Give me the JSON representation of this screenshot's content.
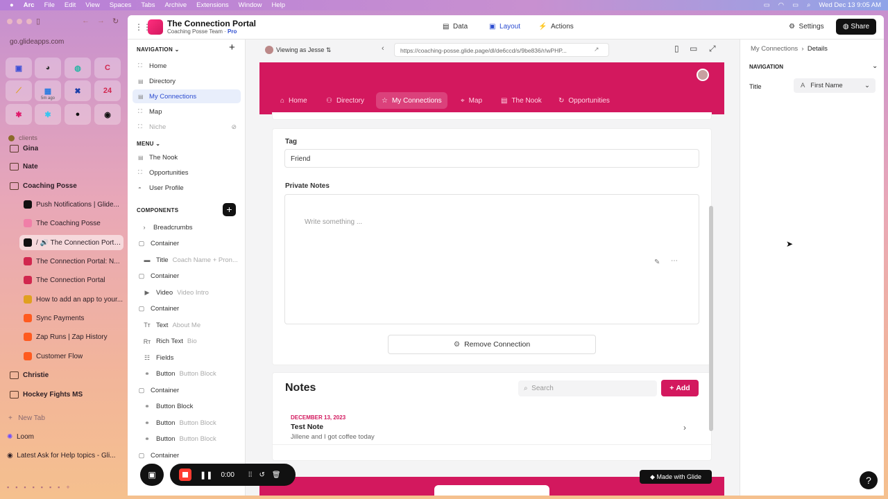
{
  "menubar": {
    "app": "Arc",
    "items": [
      "File",
      "Edit",
      "View",
      "Spaces",
      "Tabs",
      "Archive",
      "Extensions",
      "Window",
      "Help"
    ],
    "datetime": "Wed Dec 13  9:05 AM"
  },
  "arc": {
    "url": "go.glideapps.com",
    "pins": [
      {
        "glyph": "▣",
        "color": "#3c4fd6"
      },
      {
        "glyph": "◕",
        "color": "#333"
      },
      {
        "glyph": "◍",
        "color": "#28b5a5"
      },
      {
        "glyph": "C",
        "color": "#d1274e"
      },
      {
        "glyph": "⟋",
        "color": "#e0a020"
      },
      {
        "glyph": "▦",
        "color": "#2a7be0",
        "badge": "5m ago"
      },
      {
        "glyph": "✖",
        "color": "#1b3ea8"
      },
      {
        "glyph": "24",
        "color": "#d1274e"
      },
      {
        "glyph": "✱",
        "color": "#e0196b"
      },
      {
        "glyph": "✱",
        "color": "#36c5f0"
      },
      {
        "glyph": "●",
        "color": "#111"
      },
      {
        "glyph": "◉",
        "color": "#111"
      }
    ],
    "section": "clients",
    "items": [
      {
        "label": "Gina",
        "type": "folder"
      },
      {
        "label": "Nate",
        "type": "folder"
      },
      {
        "label": "Coaching Posse",
        "type": "folder"
      },
      {
        "label": "Push Notifications | Glide...",
        "type": "tab",
        "color": "#111"
      },
      {
        "label": "The Coaching Posse",
        "type": "tab",
        "color": "#f07fa8"
      },
      {
        "label": "/ 🔊 The Connection Porta...",
        "type": "tab",
        "color": "#111",
        "active": true
      },
      {
        "label": "The Connection Portal: N...",
        "type": "tab",
        "color": "#d1274e"
      },
      {
        "label": "The Connection Portal",
        "type": "tab",
        "color": "#d1274e"
      },
      {
        "label": "How to add an app to your...",
        "type": "tab",
        "color": "#e0a020"
      },
      {
        "label": "Sync Payments",
        "type": "tab",
        "color": "#ff5a1f"
      },
      {
        "label": "Zap Runs | Zap History",
        "type": "tab",
        "color": "#ff5a1f"
      },
      {
        "label": "Customer Flow",
        "type": "tab",
        "color": "#ff5a1f"
      },
      {
        "label": "Christie",
        "type": "folder"
      },
      {
        "label": "Hockey Fights MS",
        "type": "folder"
      }
    ],
    "new_tab": "New Tab",
    "loom": "Loom",
    "latest": "Latest Ask for Help topics - Gli..."
  },
  "glide": {
    "app_name": "The Connection Portal",
    "team": "Coaching Posse Team",
    "plan": "Pro",
    "top_tabs": [
      "Data",
      "Layout",
      "Actions"
    ],
    "settings": "Settings",
    "share": "Share",
    "nav_header": "NAVIGATION",
    "nav": [
      "Home",
      "Directory",
      "My Connections",
      "Map",
      "Niche"
    ],
    "menu_header": "MENU",
    "menu": [
      "The Nook",
      "Opportunities",
      "User Profile"
    ],
    "comp_header": "COMPONENTS",
    "components": [
      {
        "label": "Breadcrumbs",
        "sub": "",
        "glyph": "›"
      },
      {
        "label": "Container",
        "sub": "",
        "glyph": "▢"
      },
      {
        "label": "Title",
        "sub": "Coach Name + Pron...",
        "glyph": "▬"
      },
      {
        "label": "Container",
        "sub": "",
        "glyph": "▢"
      },
      {
        "label": "Video",
        "sub": "Video Intro",
        "glyph": "▶"
      },
      {
        "label": "Container",
        "sub": "",
        "glyph": "▢"
      },
      {
        "label": "Text",
        "sub": "About Me",
        "glyph": "Tт"
      },
      {
        "label": "Rich Text",
        "sub": "Bio",
        "glyph": "Rт"
      },
      {
        "label": "Fields",
        "sub": "",
        "glyph": "☷"
      },
      {
        "label": "Button",
        "sub": "Button Block",
        "glyph": "⚭"
      },
      {
        "label": "Container",
        "sub": "",
        "glyph": "▢"
      },
      {
        "label": "Button Block",
        "sub": "",
        "glyph": "⚭"
      },
      {
        "label": "Button",
        "sub": "Button Block",
        "glyph": "⚭"
      },
      {
        "label": "Button",
        "sub": "Button Block",
        "glyph": "⚭"
      },
      {
        "label": "Container",
        "sub": "",
        "glyph": "▢"
      }
    ],
    "viewing_as": "Viewing as Jesse",
    "preview_url": "https://coaching-posse.glide.page/dl/de6ccd/s/9be836/r/wPHP...",
    "app_tabs": [
      "Home",
      "Directory",
      "My Connections",
      "Map",
      "The Nook",
      "Opportunities"
    ],
    "tag_label": "Tag",
    "tag_value": "Friend",
    "notes_label": "Private Notes",
    "notes_placeholder": "Write something ...",
    "remove": "Remove Connection",
    "notes_title": "Notes",
    "search_placeholder": "Search",
    "add": "Add",
    "note": {
      "date": "DECEMBER 13, 2023",
      "title": "Test Note",
      "body": "Jillene and I got coffee today"
    },
    "made_with": "Made with Glide",
    "recorder_time": "0:00",
    "right": {
      "crumb1": "My Connections",
      "crumb2": "Details",
      "section": "NAVIGATION",
      "title_label": "Title",
      "title_value": "First Name"
    },
    "accent": "#d3185e"
  }
}
